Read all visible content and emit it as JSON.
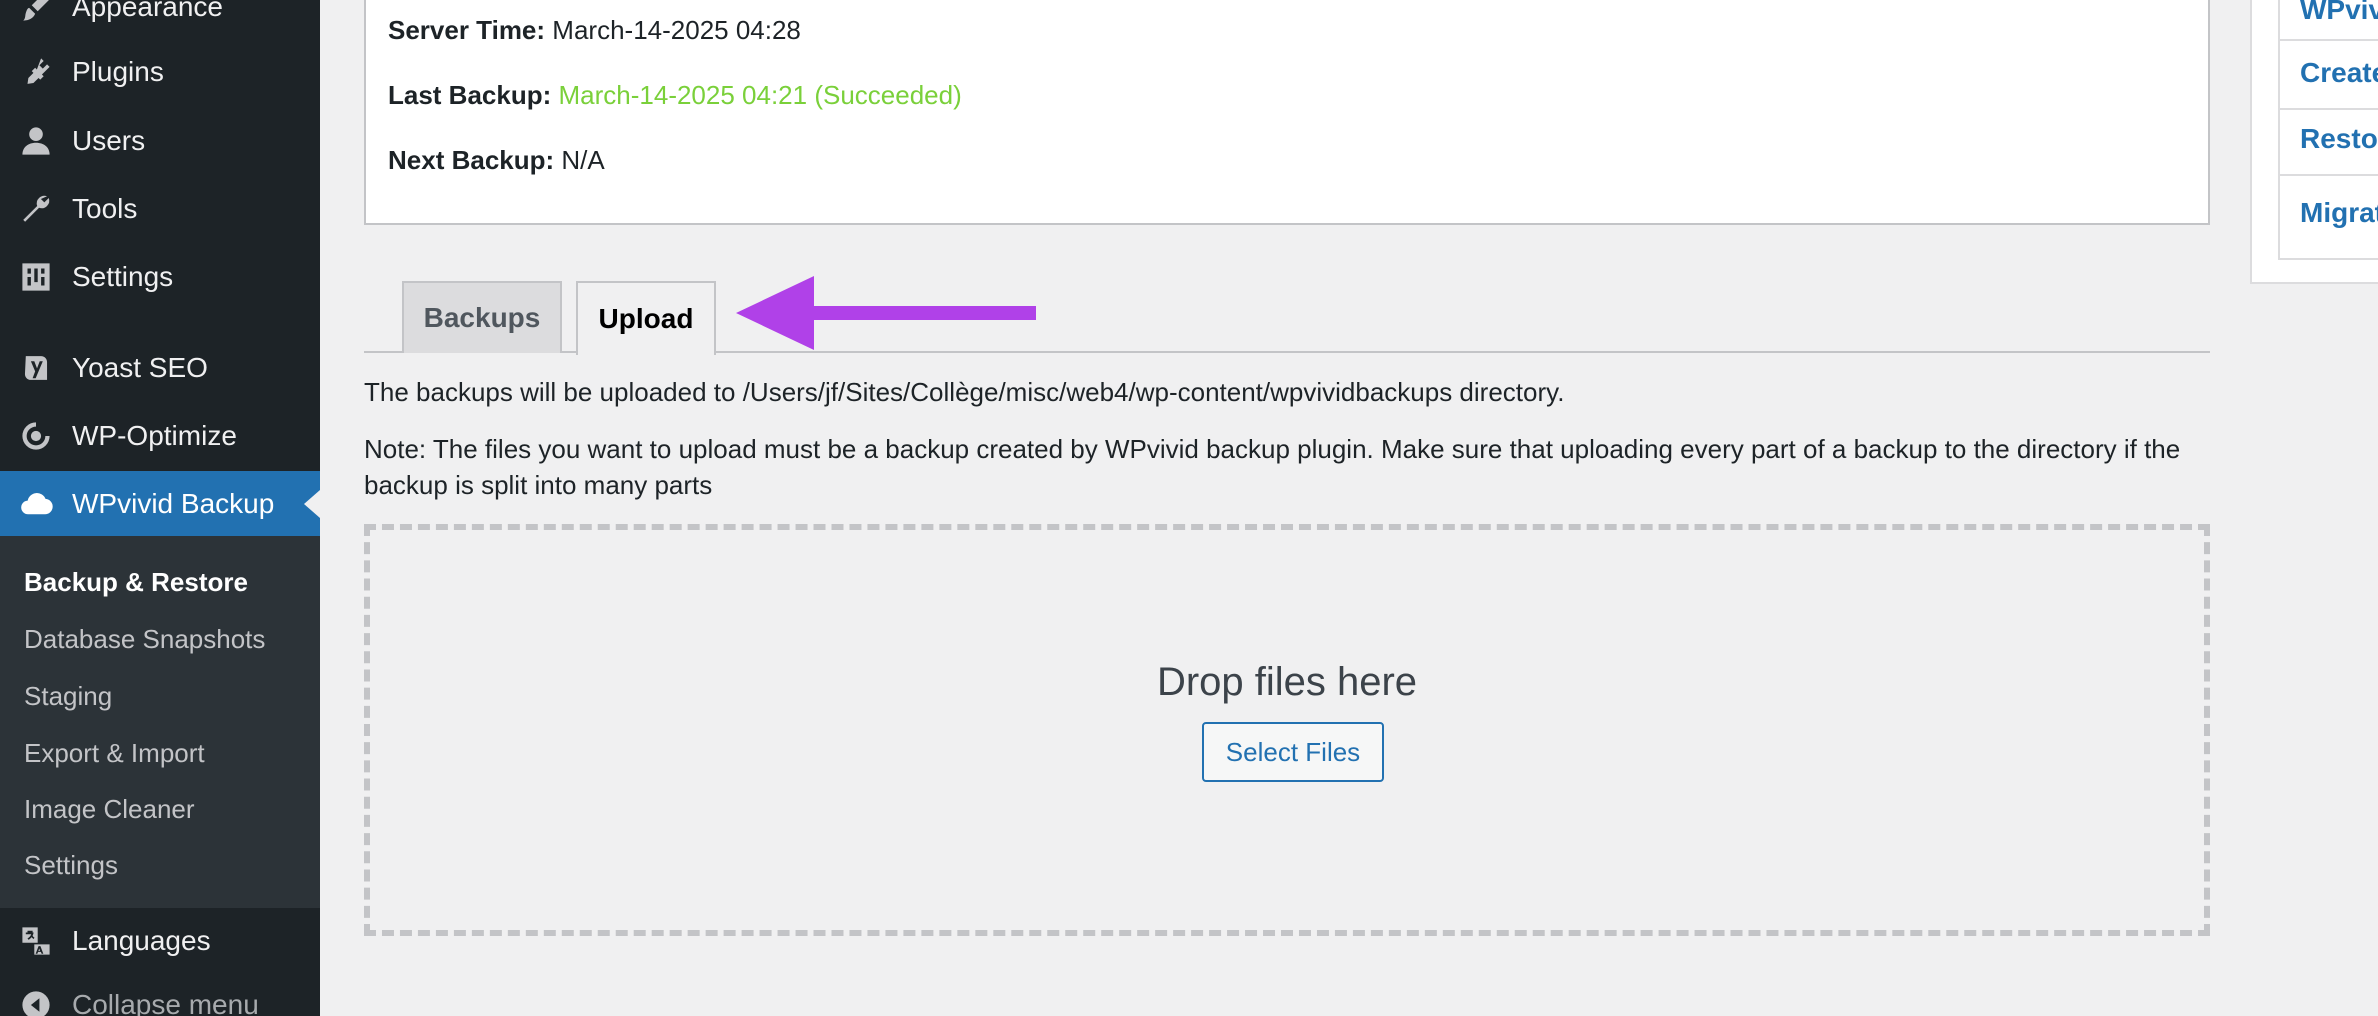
{
  "sidebar": {
    "items": [
      {
        "label": "Appearance",
        "icon": "paintbrush-icon"
      },
      {
        "label": "Plugins",
        "icon": "plugin-icon"
      },
      {
        "label": "Users",
        "icon": "user-icon"
      },
      {
        "label": "Tools",
        "icon": "wrench-icon"
      },
      {
        "label": "Settings",
        "icon": "settings-icon"
      },
      {
        "label": "Yoast SEO",
        "icon": "yoast-icon"
      },
      {
        "label": "WP-Optimize",
        "icon": "wp-optimize-icon"
      },
      {
        "label": "WPvivid Backup",
        "icon": "cloud-icon"
      }
    ],
    "submenu": [
      {
        "label": "Backup & Restore"
      },
      {
        "label": "Database Snapshots"
      },
      {
        "label": "Staging"
      },
      {
        "label": "Export & Import"
      },
      {
        "label": "Image Cleaner"
      },
      {
        "label": "Settings"
      }
    ],
    "languages": {
      "label": "Languages",
      "icon": "translation-icon"
    },
    "collapse": {
      "label": "Collapse menu",
      "icon": "collapse-icon"
    }
  },
  "status": {
    "server_time_label": "Server Time:",
    "server_time_value": "March-14-2025 04:28",
    "last_backup_label": "Last Backup:",
    "last_backup_value": "March-14-2025 04:21 (Succeeded)",
    "next_backup_label": "Next Backup:",
    "next_backup_value": "N/A"
  },
  "tabs": {
    "backups": "Backups",
    "upload": "Upload"
  },
  "upload": {
    "info": "The backups will be uploaded to /Users/jf/Sites/Collège/misc/web4/wp-content/wpvividbackups directory.",
    "note": "Note: The files you want to upload must be a backup created by WPvivid backup plugin. Make sure that uploading every part of a backup to the directory if the backup is split into many parts",
    "drop_text": "Drop files here",
    "select_button": "Select Files"
  },
  "right_panel": {
    "links": [
      "WPvivid",
      "Create",
      "Restore",
      "Migrate"
    ]
  },
  "colors": {
    "accent": "#2271b1",
    "success": "#7ad03a",
    "arrow": "#b041e8"
  }
}
